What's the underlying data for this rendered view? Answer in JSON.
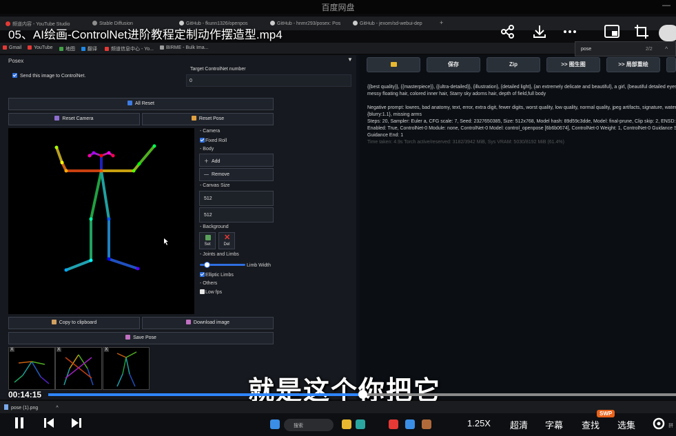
{
  "app_title": "百度网盘",
  "window_controls": "—",
  "video_title": "05、AI绘画-ControlNet进阶教程定制动作摆造型.mp4",
  "browser_tabs": [
    {
      "label": "频道内容 - YouTube Studio",
      "color": "#e53935"
    },
    {
      "label": "Stable Diffusion",
      "color": "#8e8e8e"
    },
    {
      "label": "GitHub - fkunn1326/openpos",
      "color": "#cccccc"
    },
    {
      "label": "GitHub - hnmr293/posex: Pos",
      "color": "#cccccc"
    },
    {
      "label": "GitHub - jexom/sd-webui-dep",
      "color": "#cccccc"
    }
  ],
  "new_tab": "+",
  "bookmarks": [
    {
      "label": "Gmail",
      "color": "#e53935"
    },
    {
      "label": "YouTube",
      "color": "#e53935"
    },
    {
      "label": "地图",
      "color": "#43a047"
    },
    {
      "label": "翻译",
      "color": "#1e88e5"
    },
    {
      "label": "频道信息中心 - Yo...",
      "color": "#e53935"
    },
    {
      "label": "BIRME - Bulk Ima...",
      "color": "#9e9e9e"
    }
  ],
  "find": {
    "query": "pose",
    "count": "2/2"
  },
  "posex": {
    "header": "Posex",
    "send_label": "Send this image to ControlNet.",
    "target_label": "Target ControlNet number",
    "target_value": "0",
    "all_reset": "All Reset",
    "reset_camera": "Reset Camera",
    "reset_pose": "Reset Pose",
    "camera_label": "- Camera",
    "fixed_roll": "Fixed Roll",
    "body_label": "- Body",
    "add": "Add",
    "remove": "Remove",
    "canvas_size_label": "- Canvas Size",
    "canvas_width": "512",
    "canvas_height": "512",
    "background_label": "- Background",
    "set": "Set",
    "del": "Del",
    "joints_label": "- Joints and Limbs",
    "limb_width": "Limb Width",
    "limb_width_level": 0.15,
    "elliptic_limbs": "Elliptic Limbs",
    "others_label": "- Others",
    "low_fps": "Low fps",
    "copy_clipboard": "Copy to clipboard",
    "download_image": "Download image",
    "save_pose": "Save Pose",
    "thumb_close": "X"
  },
  "right_buttons": [
    "保存",
    "Zip",
    ">> 图生图",
    ">> 局部重绘"
  ],
  "generation": {
    "prompt": "{{best quality}}, {{masterpiece}}, {{ultra-detailed}}, {illustration}, {detailed light}, {an extremely delicate and beautiful}, a girl, {beautiful detailed eyes}",
    "prompt_2": "messy floating hair, colored inner hair, Starry sky adorns hair, depth of field,full body",
    "negative": "Negative prompt: lowres, bad anatomy, text, error, extra digit, fewer digits, worst quality, low quality, normal quality, jpeg artifacts, signature, watermark",
    "negative_2": "{blurry:1.1}, missing arms",
    "params": "Steps: 20, Sampler: Euler a, CFG scale: 7, Seed: 2327650385, Size: 512x768, Model hash: 89d59c3dde, Model: final-prune, Clip skip: 2, ENSD: 31337,",
    "params_2": "Enabled: True, ControlNet-0 Module: none, ControlNet-0 Model: control_openpose [6b6b0674], ControlNet-0 Weight: 1, ControlNet-0 Guidance Start",
    "params_3": "Guidance End: 1",
    "timing": "Time taken: 4.9s  Torch active/reserved: 3182/3942 MiB, Sys VRAM: 5030/8192 MiB (61.4%)"
  },
  "subtitle": "就是这个你把它",
  "timecode": "00:14:15",
  "progress": 0.5,
  "download_file": "pose (1).png",
  "player": {
    "speed": "1.25X",
    "quality": "超清",
    "subtitles": "字幕",
    "search": "查找",
    "episodes": "选集",
    "swp_badge": "SWP",
    "taskbar_search": "搜索",
    "ime": "拼"
  }
}
